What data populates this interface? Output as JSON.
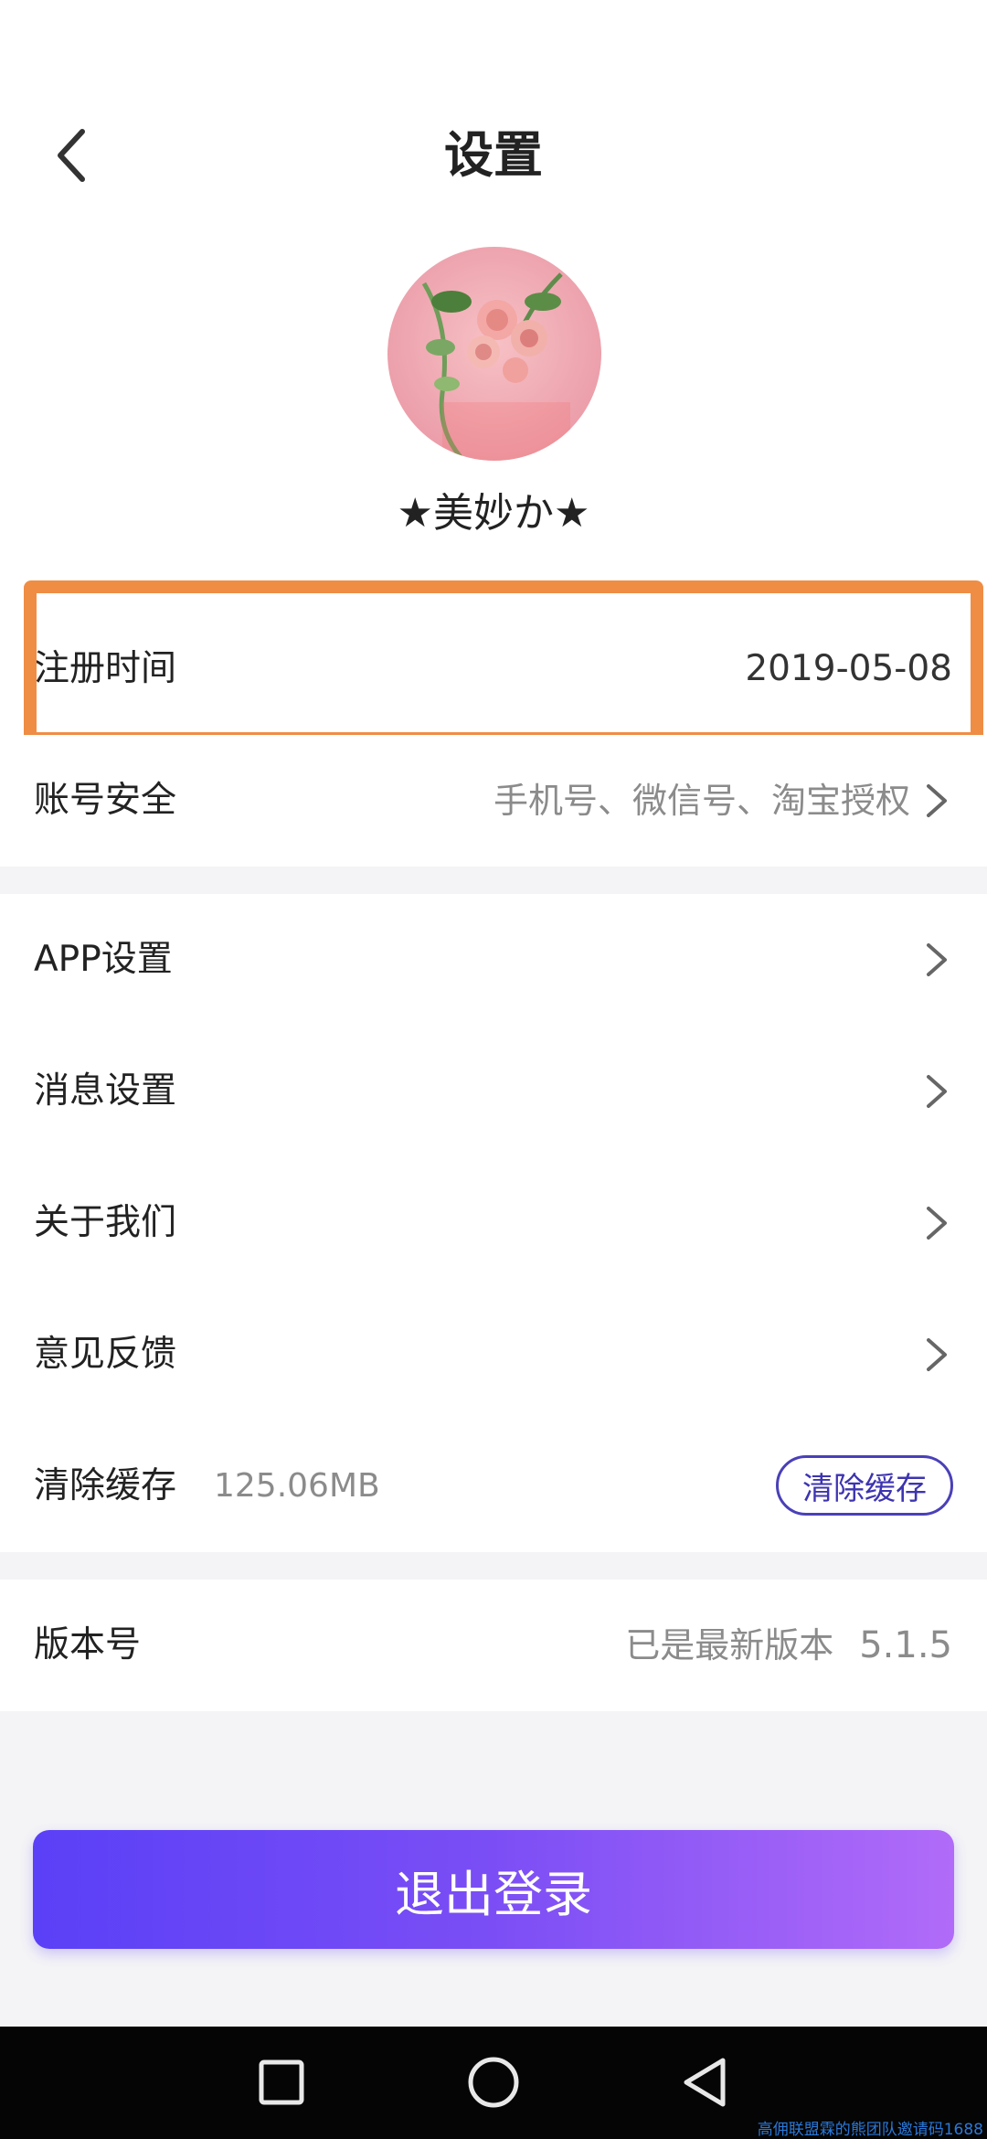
{
  "header": {
    "title": "设置"
  },
  "profile": {
    "username": "★美妙か★"
  },
  "rows": {
    "register": {
      "label": "注册时间",
      "value": "2019-05-08"
    },
    "account": {
      "label": "账号安全",
      "value": "手机号、微信号、淘宝授权"
    },
    "app": {
      "label": "APP设置"
    },
    "message": {
      "label": "消息设置"
    },
    "about": {
      "label": "关于我们"
    },
    "feedback": {
      "label": "意见反馈"
    },
    "cache": {
      "label": "清除缓存",
      "size": "125.06MB",
      "button": "清除缓存"
    },
    "version": {
      "label": "版本号",
      "status": "已是最新版本",
      "number": "5.1.5"
    }
  },
  "logout": {
    "label": "退出登录"
  },
  "watermark": "高佣联盟霖的熊团队邀请码1688",
  "colors": {
    "accent": "#5a40f7",
    "accent_end": "#b16bf8",
    "highlight": "#ef8d45"
  },
  "icons": {
    "back": "chevron-left-icon",
    "row_arrow": "chevron-right-icon",
    "nav": [
      "square-icon",
      "circle-icon",
      "triangle-back-icon"
    ]
  }
}
